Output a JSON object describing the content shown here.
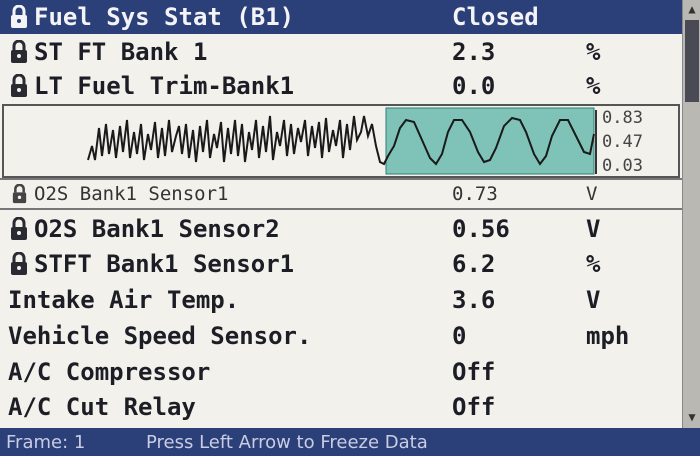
{
  "header": {
    "label": "Fuel Sys Stat (B1)",
    "value": "Closed"
  },
  "rows": [
    {
      "label": "ST FT Bank 1",
      "value": "2.3",
      "unit": "%",
      "locked": true
    },
    {
      "label": "LT Fuel Trim-Bank1",
      "value": "0.0",
      "unit": "%",
      "locked": true
    }
  ],
  "graph": {
    "scale": [
      "0.83",
      "0.47",
      "0.03"
    ],
    "highlight_color": "#7fc3b8",
    "trace_color": "#1a1a1a"
  },
  "selected_row": {
    "label": "O2S Bank1 Sensor1",
    "value": "0.73",
    "unit": "V",
    "locked": true
  },
  "rows2": [
    {
      "label": "O2S Bank1 Sensor2",
      "value": "0.56",
      "unit": "V",
      "locked": true
    },
    {
      "label": "STFT Bank1 Sensor1",
      "value": "6.2",
      "unit": "%",
      "locked": true
    },
    {
      "label": "Intake Air Temp.",
      "value": "3.6",
      "unit": "V",
      "locked": false
    },
    {
      "label": "Vehicle Speed Sensor.",
      "value": "0",
      "unit": "mph",
      "locked": false
    },
    {
      "label": "A/C Compressor",
      "value": "Off",
      "unit": "",
      "locked": false
    },
    {
      "label": "A/C Cut Relay",
      "value": "Off",
      "unit": "",
      "locked": false
    }
  ],
  "status_bar": {
    "frame": "Frame: 1",
    "message": "Press Left Arrow to Freeze Data"
  },
  "colors": {
    "header_bg": "#2b3f78",
    "screen_bg": "#f2f1ec"
  }
}
